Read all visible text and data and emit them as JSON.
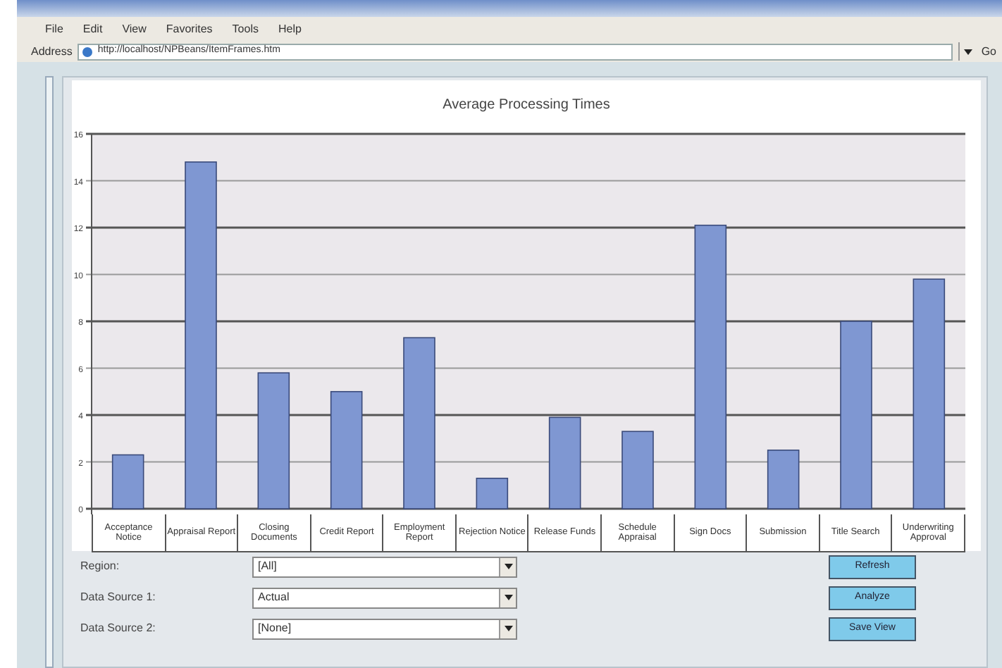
{
  "browser": {
    "menu": [
      "File",
      "Edit",
      "View",
      "Favorites",
      "Tools",
      "Help"
    ],
    "address_label": "Address",
    "url": "http://localhost/NPBeans/ItemFrames.htm",
    "go": "Go"
  },
  "chart": {
    "chart_data": {
      "type": "bar",
      "title": "Average Processing Times",
      "categories": [
        "Acceptance Notice",
        "Appraisal Report",
        "Closing Documents",
        "Credit Report",
        "Employment Report",
        "Rejection Notice",
        "Release Funds",
        "Schedule Appraisal",
        "Sign Docs",
        "Submission",
        "Title Search",
        "Underwriting Approval"
      ],
      "grid": true,
      "series": [
        {
          "color": "#7f97d2",
          "values": [
            2.3,
            14.8,
            5.8,
            5.0,
            7.3,
            1.3,
            3.9,
            3.3,
            12.1,
            2.5,
            8.0,
            9.8
          ]
        }
      ],
      "ylim": [
        0,
        16
      ],
      "yticks": [
        0,
        2,
        4,
        6,
        8,
        10,
        12,
        14,
        16
      ]
    }
  },
  "filters": [
    {
      "label": "Region:",
      "value": "[All]"
    },
    {
      "label": "Data Source 1:",
      "value": "Actual"
    },
    {
      "label": "Data Source 2:",
      "value": "[None]"
    }
  ],
  "buttons": [
    "Refresh",
    "Analyze",
    "Save View"
  ]
}
